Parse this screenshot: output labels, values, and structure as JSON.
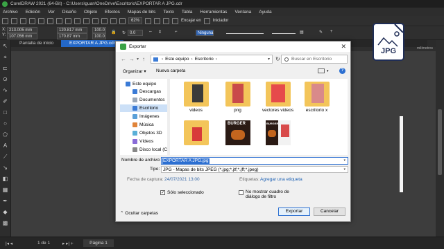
{
  "app": {
    "title": "CorelDRAW 2021 (64-Bit) - C:\\Users\\guan\\OneDrive\\Escritorio\\EXPORTAR A JPG.cdr"
  },
  "menu": [
    "Archivo",
    "Edición",
    "Ver",
    "Diseño",
    "Objeto",
    "Efectos",
    "Mapas de bits",
    "Texto",
    "Tabla",
    "Herramientas",
    "Ventana",
    "Ayuda"
  ],
  "toolbar": {
    "zoom": "62%",
    "snap": "Encajar en",
    "launcher": "Iniciador"
  },
  "properties": {
    "x": "213.005 mm",
    "y": "107.056 mm",
    "width": "120.817 mm",
    "height": "170.87 mm",
    "scale_w": "100.0",
    "scale_h": "100.0",
    "angle": "0.0",
    "outline": "Ninguna"
  },
  "tabs": {
    "home": "Pantalla de inicio",
    "document": "EXPORTAR A JPG.cdr"
  },
  "ruler_units": "milímetros",
  "jpg_badge": "JPG",
  "status": {
    "page_count": "1 de 1",
    "page_tab": "Página 1"
  },
  "dialog": {
    "title": "Exportar",
    "path": [
      "Este equipo",
      "Escritorio"
    ],
    "search_placeholder": "Buscar en Escritorio",
    "organize": "Organizar ▾",
    "new_folder": "Nueva carpeta",
    "nav_items": [
      {
        "label": "Este equipo",
        "icon": "computer-icon",
        "color": "#3b7bd6"
      },
      {
        "label": "Descargas",
        "icon": "download-folder-icon",
        "color": "#3b7bd6"
      },
      {
        "label": "Documentos",
        "icon": "documents-folder-icon",
        "color": "#9aa7b8"
      },
      {
        "label": "Escritorio",
        "icon": "desktop-folder-icon",
        "color": "#3b7bd6"
      },
      {
        "label": "Imágenes",
        "icon": "pictures-folder-icon",
        "color": "#5aa0d8"
      },
      {
        "label": "Música",
        "icon": "music-folder-icon",
        "color": "#e0843a"
      },
      {
        "label": "Objetos 3D",
        "icon": "objects3d-folder-icon",
        "color": "#5ab0d8"
      },
      {
        "label": "Vídeos",
        "icon": "videos-folder-icon",
        "color": "#8a6cd8"
      },
      {
        "label": "Disco local (C:)",
        "icon": "disk-icon",
        "color": "#888888"
      }
    ],
    "files": [
      {
        "name": "videos"
      },
      {
        "name": "png"
      },
      {
        "name": "vectores videos"
      },
      {
        "name": "escritorio x"
      },
      {
        "name": ""
      },
      {
        "name": "BURGER"
      },
      {
        "name": "BURGER"
      },
      {
        "name": ""
      }
    ],
    "filename_label": "Nombre de archivo:",
    "filename_value": "EXPORTAR A JPG.jpg",
    "type_label": "Tipo:",
    "type_value": "JPG - Mapas de bits JPEG (*.jpg;*.jtf;*.jff;*.jpeg)",
    "capture_label": "Fecha de captura:",
    "capture_value": "24/07/2021 13:00",
    "tags_label": "Etiquetas:",
    "tags_link": "Agregar una etiqueta",
    "only_selected": "Sólo seleccionado",
    "no_filter": "No mostrar cuadro de diálogo de filtro",
    "export_button": "Exportar",
    "cancel_button": "Cancelar",
    "hide_folders": "Ocultar carpetas"
  }
}
